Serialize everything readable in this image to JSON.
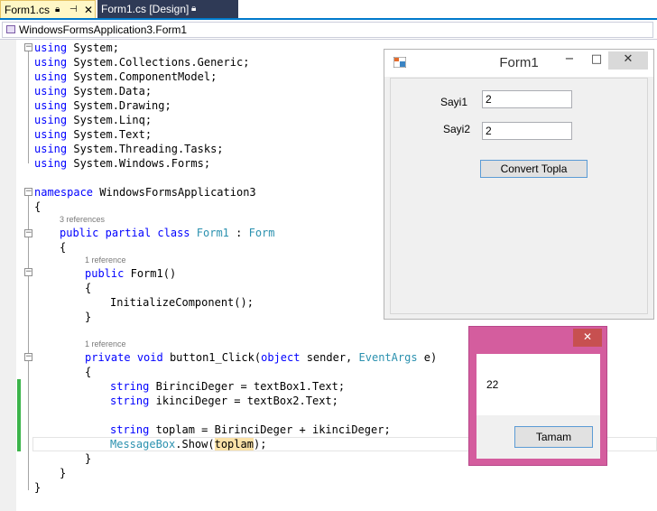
{
  "tabs": [
    {
      "label": "Form1.cs",
      "active": true
    },
    {
      "label": "Form1.cs [Design]",
      "active": false
    }
  ],
  "navbar": {
    "class_path": "WindowsFormsApplication3.Form1"
  },
  "code": {
    "usings": [
      "System;",
      "System.Collections.Generic;",
      "System.ComponentModel;",
      "System.Data;",
      "System.Drawing;",
      "System.Linq;",
      "System.Text;",
      "System.Threading.Tasks;",
      "System.Windows.Forms;"
    ],
    "using_kw": "using",
    "namespace_kw": "namespace",
    "namespace_name": "WindowsFormsApplication3",
    "lens_class": "3 references",
    "lens_ctor": "1 reference",
    "lens_method": "1 reference",
    "class_public": "public",
    "class_partial": "partial",
    "class_kw": "class",
    "class_name": "Form1",
    "class_colon": ":",
    "class_base": "Form",
    "ctor_public": "public",
    "ctor_sig": "Form1()",
    "ctor_body": "InitializeComponent();",
    "method_private": "private",
    "method_void": "void",
    "method_name": "button1_Click(",
    "method_object": "object",
    "method_sender": "sender,",
    "method_eventargs": "EventArgs",
    "method_e": "e)",
    "kw_string": "string",
    "line_birinci": "BirinciDeger = textBox1.Text;",
    "line_ikinci": "ikinciDeger = textBox2.Text;",
    "line_toplam": "toplam = BirinciDeger + ikinciDeger;",
    "messagebox_type": "MessageBox",
    "messagebox_call": ".Show(",
    "messagebox_arg": "toplam",
    "messagebox_end": ");",
    "brace_open": "{",
    "brace_close": "}"
  },
  "form1": {
    "title": "Form1",
    "label1": "Sayi1",
    "label2": "Sayi2",
    "textbox1_value": "2",
    "textbox2_value": "2",
    "button_label": "Convert Topla"
  },
  "messagebox": {
    "text": "22",
    "ok_label": "Tamam"
  }
}
